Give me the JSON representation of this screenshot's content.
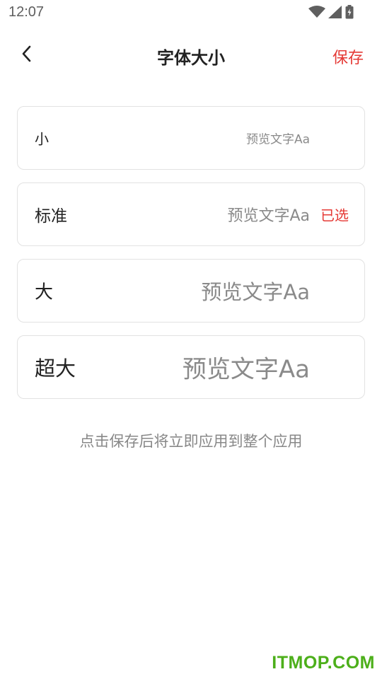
{
  "status_bar": {
    "time": "12:07",
    "icons": [
      "wifi-icon",
      "cellular-signal-icon",
      "battery-charging-icon"
    ]
  },
  "header": {
    "back_icon": "chevron-left-icon",
    "title": "字体大小",
    "save_label": "保存"
  },
  "options": [
    {
      "label": "小",
      "preview": "预览文字Aa",
      "selected": false
    },
    {
      "label": "标准",
      "preview": "预览文字Aa",
      "selected": true,
      "selected_label": "已选"
    },
    {
      "label": "大",
      "preview": "预览文字Aa",
      "selected": false
    },
    {
      "label": "超大",
      "preview": "预览文字Aa",
      "selected": false
    }
  ],
  "hint": "点击保存后将立即应用到整个应用",
  "watermark": "ITMOP.COM",
  "colors": {
    "accent": "#e53935",
    "card_border": "#e2e2e2",
    "text_primary": "#222222",
    "text_secondary": "#8a8a8a",
    "watermark": "#4caf1a"
  }
}
